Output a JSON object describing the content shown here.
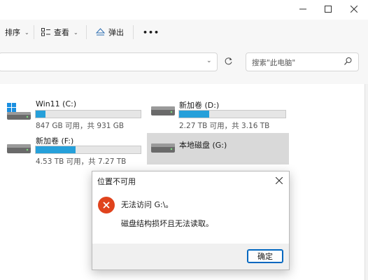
{
  "window": {
    "minimize_icon": "minimize-icon",
    "maximize_icon": "maximize-icon",
    "close_icon": "close-icon"
  },
  "toolbar": {
    "sort_label": "排序",
    "view_label": "查看",
    "eject_label": "弹出",
    "more_label": "•••"
  },
  "address": {
    "search_placeholder": "搜索\"此电脑\""
  },
  "drives": [
    {
      "name": "Win11 (C:)",
      "stats": "847 GB 可用，共 931 GB",
      "used_fraction": 0.09,
      "type": "system"
    },
    {
      "name": "新加卷 (D:)",
      "stats": "2.27 TB 可用，共 3.16 TB",
      "used_fraction": 0.28,
      "type": "disk"
    },
    {
      "name": "新加卷 (F:)",
      "stats": "4.53 TB 可用，共 7.27 TB",
      "used_fraction": 0.38,
      "type": "disk"
    },
    {
      "name": "本地磁盘 (G:)",
      "stats": "",
      "used_fraction": null,
      "type": "disk",
      "selected": true
    }
  ],
  "dialog": {
    "title": "位置不可用",
    "message1": "无法访问 G:\\。",
    "message2": "磁盘结构损坏且无法读取。",
    "ok_label": "确定"
  },
  "colors": {
    "accent": "#26a0da",
    "error": "#e0431d",
    "selection": "#d9d9d9"
  }
}
